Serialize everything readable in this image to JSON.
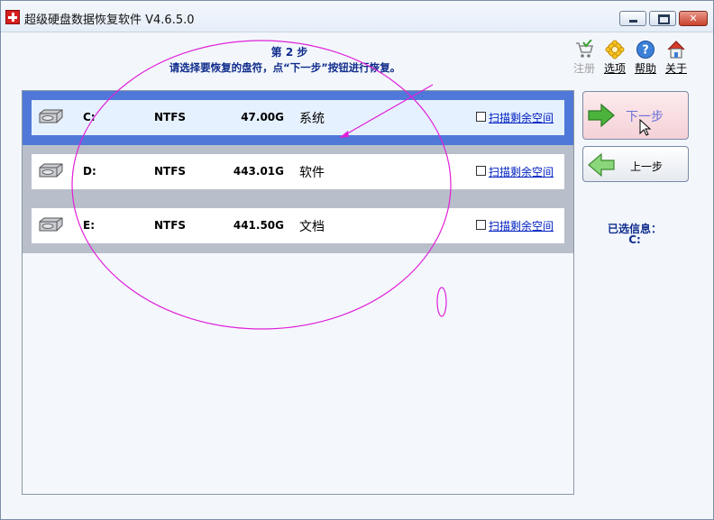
{
  "window": {
    "title": "超级硬盘数据恢复软件 V4.6.5.0",
    "controls": [
      "minimize",
      "maximize",
      "close"
    ]
  },
  "header": {
    "step_title": "第 2 步",
    "step_desc": "请选择要恢复的盘符，点“下一步”按钮进行恢复。"
  },
  "toolbar": {
    "items": [
      {
        "label": "注册",
        "icon": "cart-icon",
        "enabled": false
      },
      {
        "label": "选项",
        "icon": "gear-icon",
        "enabled": true
      },
      {
        "label": "帮助",
        "icon": "help-icon",
        "enabled": true
      },
      {
        "label": "关于",
        "icon": "home-icon",
        "enabled": true
      }
    ]
  },
  "drives": [
    {
      "letter": "C:",
      "fs": "NTFS",
      "size": "47.00G",
      "name": "系统",
      "scan_label": "扫描剩余空间",
      "selected": true
    },
    {
      "letter": "D:",
      "fs": "NTFS",
      "size": "443.01G",
      "name": "软件",
      "scan_label": "扫描剩余空间",
      "selected": false
    },
    {
      "letter": "E:",
      "fs": "NTFS",
      "size": "441.50G",
      "name": "文档",
      "scan_label": "扫描剩余空间",
      "selected": false
    }
  ],
  "actions": {
    "next_label": "下一步",
    "prev_label": "上一步"
  },
  "selection_info": {
    "title": "已选信息：",
    "value": "C:"
  },
  "colors": {
    "accent_text": "#102c8c",
    "selected_row": "#4f78d8",
    "annotation": "#e020d8"
  }
}
